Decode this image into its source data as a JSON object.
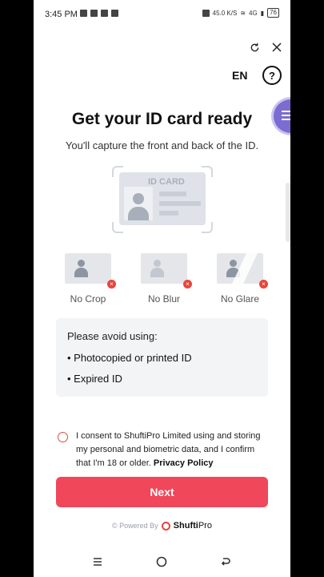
{
  "status_bar": {
    "time": "3:45 PM",
    "net_speed": "45.0 K/S",
    "network": "4G",
    "battery": "76"
  },
  "header": {
    "language": "EN",
    "help_label": "?"
  },
  "main": {
    "title": "Get your ID card ready",
    "subtitle": "You'll capture the front and back of the ID.",
    "id_card_label": "ID CARD",
    "examples": [
      {
        "label": "No Crop"
      },
      {
        "label": "No Blur"
      },
      {
        "label": "No Glare"
      }
    ],
    "avoid": {
      "title": "Please avoid using:",
      "items": [
        "Photocopied or printed ID",
        "Expired ID"
      ]
    },
    "consent": {
      "text": "I consent to ShuftiPro Limited using and storing my personal and biometric data, and I confirm that I'm 18 or older.",
      "link": "Privacy Policy"
    },
    "next_label": "Next"
  },
  "footer": {
    "powered_by": "© Powered By",
    "brand_bold": "Shufti",
    "brand_light": "Pro"
  },
  "colors": {
    "accent": "#f0475a",
    "error": "#e8453c",
    "bubble": "#7b6cd1"
  }
}
